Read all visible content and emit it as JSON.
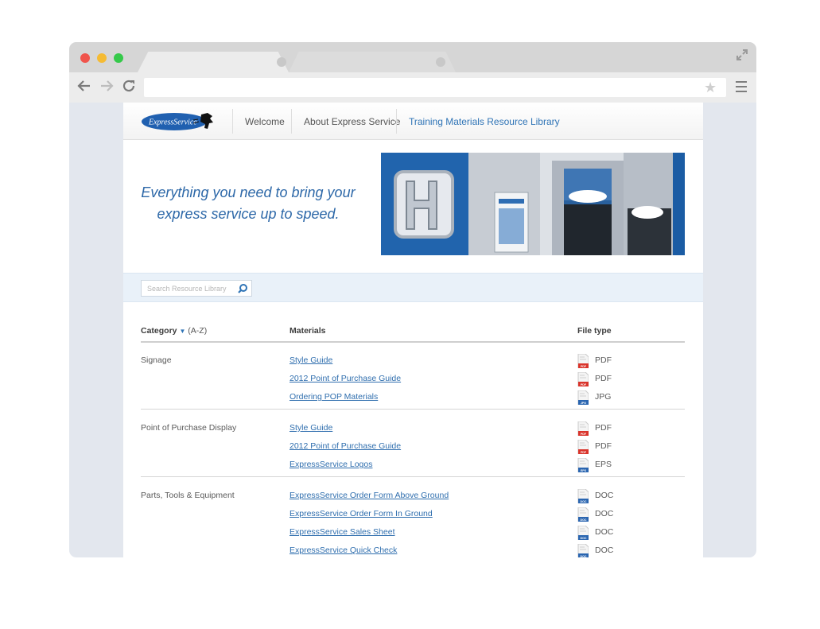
{
  "site": {
    "nav": [
      "Welcome",
      "About Express Service",
      "Training Materials Resource Library"
    ],
    "tagline_line1": "Everything you need to bring your",
    "tagline_line2": "express service up to speed."
  },
  "search": {
    "placeholder": "Search Resource Library"
  },
  "table": {
    "header_category": "Category",
    "header_sort": "(A-Z)",
    "header_materials": "Materials",
    "header_filetype": "File type",
    "groups": [
      {
        "category": "Signage",
        "items": [
          {
            "material": "Style Guide",
            "type": "PDF",
            "badge": "PDF"
          },
          {
            "material": "2012 Point of Purchase Guide",
            "type": "PDF",
            "badge": "PDF"
          },
          {
            "material": "Ordering POP Materials",
            "type": "JPG",
            "badge": "JPG"
          }
        ]
      },
      {
        "category": "Point of Purchase Display",
        "items": [
          {
            "material": "Style Guide",
            "type": "PDF",
            "badge": "PDF"
          },
          {
            "material": "2012 Point of Purchase Guide",
            "type": "PDF",
            "badge": "PDF"
          },
          {
            "material": "ExpressService Logos",
            "type": "EPS",
            "badge": "EPS"
          }
        ]
      },
      {
        "category": "Parts, Tools & Equipment",
        "items": [
          {
            "material": "ExpressService Order Form Above Ground",
            "type": "DOC",
            "badge": "DOC"
          },
          {
            "material": "ExpressService Order Form In Ground",
            "type": "DOC",
            "badge": "DOC"
          },
          {
            "material": "ExpressService Sales Sheet",
            "type": "DOC",
            "badge": "DOC"
          },
          {
            "material": "ExpressService Quick Check",
            "type": "DOC",
            "badge": "DOC"
          }
        ]
      }
    ]
  },
  "logo": {
    "text": "ExpressService"
  },
  "colors": {
    "accent": "#2f74b6",
    "pdf": "#d9342b",
    "doc": "#2a65b0"
  }
}
